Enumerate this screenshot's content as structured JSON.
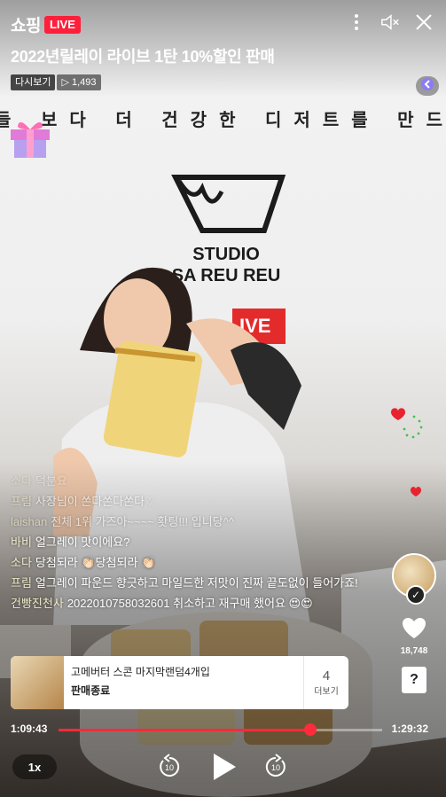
{
  "header": {
    "brand": "쇼핑",
    "live_badge": "LIVE",
    "title": "2022년릴레이 라이브 1탄 10%할인 판매",
    "replay_label": "다시보기",
    "view_count": "▷ 1,493"
  },
  "video": {
    "banner_text": "들 보다 더 건강한 디저트를 만드는",
    "store_logo_line1": "STUDIO",
    "store_logo_line2": "SA REU REU",
    "sign_text": "IVE"
  },
  "chat": [
    {
      "nick": "소다",
      "text": "덕분요",
      "style": "fade1"
    },
    {
      "nick": "프림",
      "text": "사장님이 쏜다쏜다쏜다♡",
      "style": "fade2"
    },
    {
      "nick": "laishan",
      "text": "전체 1위 가즈아~~~~ 홧팅!!! 입니당^^",
      "style": "fade2"
    },
    {
      "nick": "바비",
      "text": "얼그레이 맛이에요?",
      "style": ""
    },
    {
      "nick": "소다",
      "text": "당첨되라 👏🏻당첨되라 👏🏻",
      "style": ""
    },
    {
      "nick": "프림",
      "text": "얼그레이 파운드 향긋하고 마일드한 저맛이 진짜 끝도없이 들어가죠!",
      "style": ""
    },
    {
      "nick": "건빵진천사",
      "text": "2022010758032601 취소하고 재구매 했어요 😍😍",
      "style": ""
    }
  ],
  "side": {
    "like_count": "18,748",
    "qa_label": "?"
  },
  "product": {
    "name": "고메버터 스콘 마지막랜덤4개입",
    "status": "판매종료",
    "more_count": "4",
    "more_label": "더보기"
  },
  "player": {
    "current_time": "1:09:43",
    "duration": "1:29:32",
    "progress": 0.778,
    "speed": "1x",
    "rewind_label": "10",
    "forward_label": "10"
  },
  "colors": {
    "live_red": "#ff1f3a",
    "progress_red": "#ff2a3b"
  }
}
